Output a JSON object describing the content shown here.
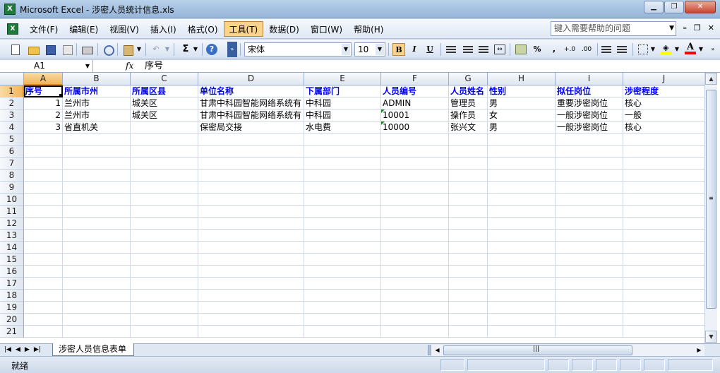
{
  "window": {
    "title": "Microsoft Excel - 涉密人员统计信息.xls",
    "app_icon": "X"
  },
  "menus": [
    "文件(F)",
    "编辑(E)",
    "视图(V)",
    "插入(I)",
    "格式(O)",
    "工具(T)",
    "数据(D)",
    "窗口(W)",
    "帮助(H)"
  ],
  "active_menu_index": 5,
  "help": {
    "placeholder": "键入需要帮助的问题"
  },
  "toolbar": {
    "font": "宋体",
    "size": "10",
    "bold_label": "B",
    "italic_label": "I",
    "underline_label": "U",
    "sum_label": "Σ",
    "percent_label": "%",
    "comma_label": ",",
    "inc_decimal_label": "+.0",
    "dec_decimal_label": ".00",
    "fill_color": "#ffff00",
    "font_color": "#ff0000"
  },
  "formula": {
    "cell": "A1",
    "fx": "fx",
    "value": "序号"
  },
  "columns": [
    "A",
    "B",
    "C",
    "D",
    "E",
    "F",
    "G",
    "H",
    "I",
    "J"
  ],
  "row_numbers": [
    "1",
    "2",
    "3",
    "4",
    "5",
    "6",
    "7",
    "8",
    "9",
    "10",
    "11",
    "12",
    "13",
    "14",
    "15",
    "16",
    "17",
    "18",
    "19",
    "20",
    "21"
  ],
  "header_row": [
    "序号",
    "所属市州",
    "所属区县",
    "单位名称",
    "下属部门",
    "人员编号",
    "人员姓名",
    "性别",
    "拟任岗位",
    "涉密程度"
  ],
  "data_rows": [
    [
      "1",
      "兰州市",
      "城关区",
      "甘肃中科园智能网络系统有",
      "中科园",
      "ADMIN",
      "管理员",
      "男",
      "重要涉密岗位",
      "核心"
    ],
    [
      "2",
      "兰州市",
      "城关区",
      "甘肃中科园智能网络系统有",
      "中科园",
      "10001",
      "操作员",
      "女",
      "一般涉密岗位",
      "一般"
    ],
    [
      "3",
      "省直机关",
      "",
      "保密局交接",
      "水电费",
      "10000",
      "张兴文",
      "男",
      "一般涉密岗位",
      "核心"
    ]
  ],
  "sheet_tab": "涉密人员信息表单",
  "status": "就绪"
}
